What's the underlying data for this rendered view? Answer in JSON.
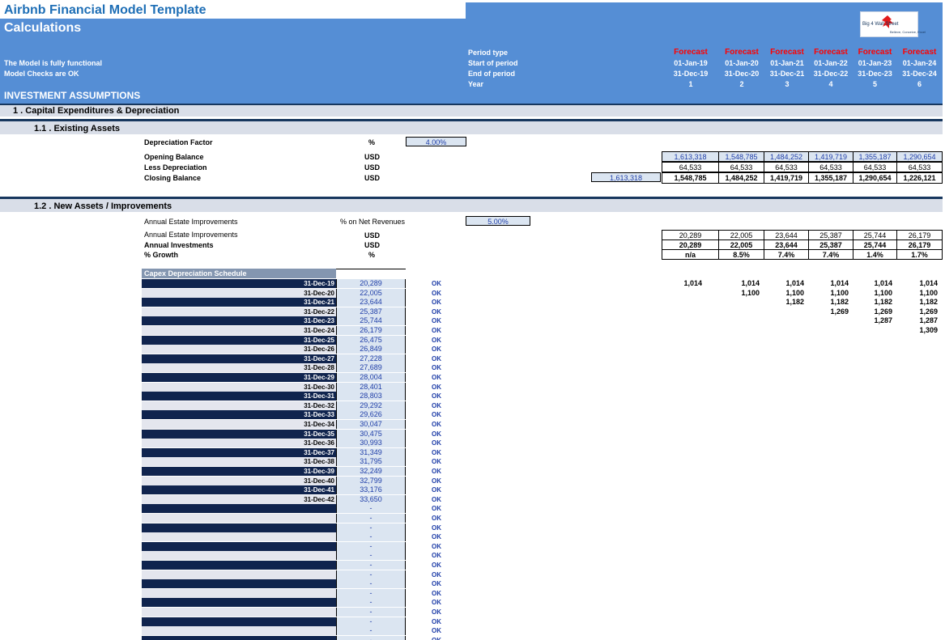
{
  "title": "Airbnb Financial Model Template",
  "subtitle": "Calculations",
  "status_lines": [
    "The Model is fully functional",
    "Model Checks are OK"
  ],
  "logo_text": "Big 4 Wall Street",
  "logo_sub": "Believe, Conceive, Excel",
  "section_title": "INVESTMENT ASSUMPTIONS",
  "period_labels": [
    "Period type",
    "Start of period",
    "End of period",
    "Year"
  ],
  "periods": [
    {
      "type": "Forecast",
      "start": "01-Jan-19",
      "end": "31-Dec-19",
      "year": "1"
    },
    {
      "type": "Forecast",
      "start": "01-Jan-20",
      "end": "31-Dec-20",
      "year": "2"
    },
    {
      "type": "Forecast",
      "start": "01-Jan-21",
      "end": "31-Dec-21",
      "year": "3"
    },
    {
      "type": "Forecast",
      "start": "01-Jan-22",
      "end": "31-Dec-22",
      "year": "4"
    },
    {
      "type": "Forecast",
      "start": "01-Jan-23",
      "end": "31-Dec-23",
      "year": "5"
    },
    {
      "type": "Forecast",
      "start": "01-Jan-24",
      "end": "31-Dec-24",
      "year": "6"
    }
  ],
  "sec1": {
    "title": "1 .  Capital Expenditures & Depreciation",
    "sub1": {
      "title": "1.1 .  Existing Assets",
      "dep_factor": {
        "label": "Depreciation Factor",
        "unit": "%",
        "value": "4.00%"
      },
      "rows": [
        {
          "label": "Opening Balance",
          "unit": "USD",
          "values": [
            "1,613,318",
            "1,548,785",
            "1,484,252",
            "1,419,719",
            "1,355,187",
            "1,290,654"
          ]
        },
        {
          "label": "Less Depreciation",
          "unit": "USD",
          "values": [
            "64,533",
            "64,533",
            "64,533",
            "64,533",
            "64,533",
            "64,533"
          ]
        },
        {
          "label": "Closing Balance",
          "unit": "USD",
          "initial": "1,613,318",
          "values": [
            "1,548,785",
            "1,484,252",
            "1,419,719",
            "1,355,187",
            "1,290,654",
            "1,226,121"
          ]
        }
      ]
    },
    "sub2": {
      "title": "1.2 .  New Assets / Improvements",
      "improve": {
        "label": "Annual Estate Improvements",
        "unit": "% on Net Revenues",
        "value": "5.00%"
      },
      "rows": [
        {
          "label": "Annual Estate Improvements",
          "unit": "USD",
          "values": [
            "20,289",
            "22,005",
            "23,644",
            "25,387",
            "25,744",
            "26,179"
          ]
        },
        {
          "label": "Annual Investments",
          "unit": "USD",
          "values": [
            "20,289",
            "22,005",
            "23,644",
            "25,387",
            "25,744",
            "26,179"
          ]
        },
        {
          "label": "% Growth",
          "unit": "%",
          "values": [
            "n/a",
            "8.5%",
            "7.4%",
            "7.4%",
            "1.4%",
            "1.7%"
          ]
        }
      ]
    }
  },
  "schedule": {
    "title": "Capex Depreciation Schedule",
    "ok_label": "OK",
    "dash": "-",
    "rows": [
      {
        "date": "31-Dec-19",
        "value": "20,289"
      },
      {
        "date": "31-Dec-20",
        "value": "22,005"
      },
      {
        "date": "31-Dec-21",
        "value": "23,644"
      },
      {
        "date": "31-Dec-22",
        "value": "25,387"
      },
      {
        "date": "31-Dec-23",
        "value": "25,744"
      },
      {
        "date": "31-Dec-24",
        "value": "26,179"
      },
      {
        "date": "31-Dec-25",
        "value": "26,475"
      },
      {
        "date": "31-Dec-26",
        "value": "26,849"
      },
      {
        "date": "31-Dec-27",
        "value": "27,228"
      },
      {
        "date": "31-Dec-28",
        "value": "27,689"
      },
      {
        "date": "31-Dec-29",
        "value": "28,004"
      },
      {
        "date": "31-Dec-30",
        "value": "28,401"
      },
      {
        "date": "31-Dec-31",
        "value": "28,803"
      },
      {
        "date": "31-Dec-32",
        "value": "29,292"
      },
      {
        "date": "31-Dec-33",
        "value": "29,626"
      },
      {
        "date": "31-Dec-34",
        "value": "30,047"
      },
      {
        "date": "31-Dec-35",
        "value": "30,475"
      },
      {
        "date": "31-Dec-36",
        "value": "30,993"
      },
      {
        "date": "31-Dec-37",
        "value": "31,349"
      },
      {
        "date": "31-Dec-38",
        "value": "31,795"
      },
      {
        "date": "31-Dec-39",
        "value": "32,249"
      },
      {
        "date": "31-Dec-40",
        "value": "32,799"
      },
      {
        "date": "31-Dec-41",
        "value": "33,176"
      },
      {
        "date": "31-Dec-42",
        "value": "33,650"
      },
      {
        "date": "",
        "value": "-"
      },
      {
        "date": "",
        "value": "-"
      },
      {
        "date": "",
        "value": "-"
      },
      {
        "date": "",
        "value": "-"
      },
      {
        "date": "",
        "value": "-"
      },
      {
        "date": "",
        "value": "-"
      },
      {
        "date": "",
        "value": "-"
      },
      {
        "date": "",
        "value": "-"
      },
      {
        "date": "",
        "value": "-"
      },
      {
        "date": "",
        "value": "-"
      },
      {
        "date": "",
        "value": "-"
      },
      {
        "date": "",
        "value": "-"
      },
      {
        "date": "",
        "value": "-"
      },
      {
        "date": "",
        "value": "-"
      },
      {
        "date": "",
        "value": "-"
      },
      {
        "date": "",
        "value": "-"
      }
    ],
    "depreciation": [
      [
        "1,014",
        "1,014",
        "1,014",
        "1,014",
        "1,014",
        "1,014"
      ],
      [
        "",
        "1,100",
        "1,100",
        "1,100",
        "1,100",
        "1,100"
      ],
      [
        "",
        "",
        "1,182",
        "1,182",
        "1,182",
        "1,182"
      ],
      [
        "",
        "",
        "",
        "1,269",
        "1,269",
        "1,269"
      ],
      [
        "",
        "",
        "",
        "",
        "1,287",
        "1,287"
      ],
      [
        "",
        "",
        "",
        "",
        "",
        "1,309"
      ]
    ]
  }
}
